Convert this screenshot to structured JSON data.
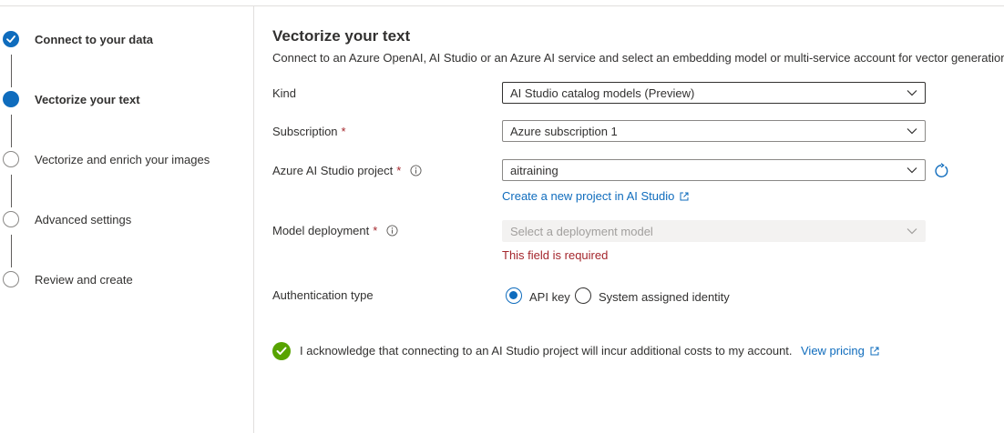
{
  "steps": [
    {
      "label": "Connect to your data",
      "state": "done"
    },
    {
      "label": "Vectorize your text",
      "state": "current"
    },
    {
      "label": "Vectorize and enrich your images",
      "state": "pending"
    },
    {
      "label": "Advanced settings",
      "state": "pending"
    },
    {
      "label": "Review and create",
      "state": "pending"
    }
  ],
  "main": {
    "title": "Vectorize your text",
    "description": "Connect to an Azure OpenAI, AI Studio or an Azure AI service and select an embedding model or multi-service account for vector generation.",
    "kind": {
      "label": "Kind",
      "value": "AI Studio catalog models (Preview)"
    },
    "subscription": {
      "label": "Subscription",
      "required_mark": "*",
      "value": "Azure subscription 1"
    },
    "project": {
      "label": "Azure AI Studio project",
      "required_mark": "*",
      "value": "aitraining",
      "link": "Create a new project in AI Studio"
    },
    "model": {
      "label": "Model deployment",
      "required_mark": "*",
      "placeholder": "Select a deployment model",
      "error": "This field is required"
    },
    "auth": {
      "label": "Authentication type",
      "options": [
        {
          "label": "API key",
          "selected": true
        },
        {
          "label": "System assigned identity",
          "selected": false
        }
      ]
    },
    "ack": {
      "text": "I acknowledge that connecting to an AI Studio project will incur additional costs to my account.",
      "link": "View pricing",
      "checked": true
    }
  },
  "colors": {
    "accent": "#0f6cbd",
    "error": "#a4262c",
    "success": "#57a300"
  }
}
